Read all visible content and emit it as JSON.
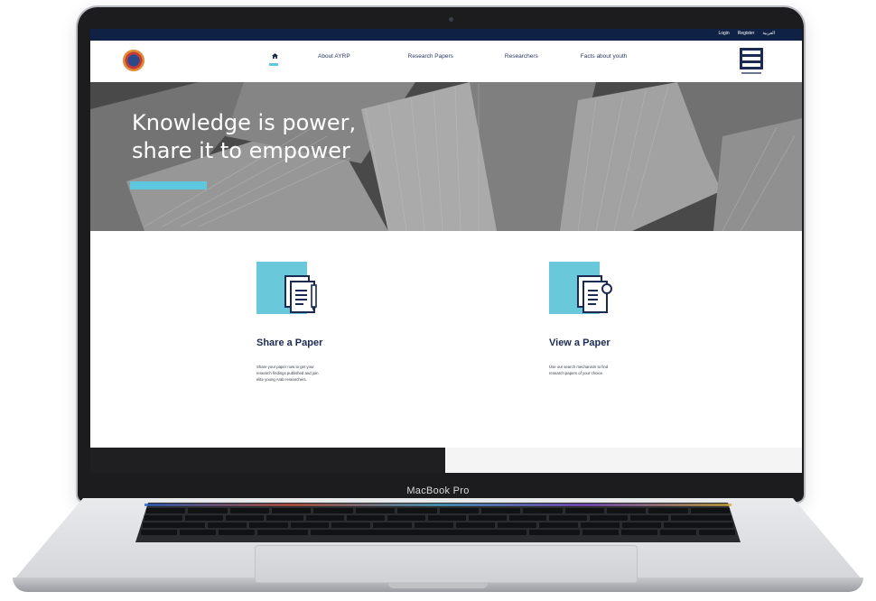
{
  "device": {
    "label": "MacBook Pro"
  },
  "topbar": {
    "links": [
      {
        "label": "Login"
      },
      {
        "label": "Register"
      },
      {
        "label": "العربية"
      }
    ]
  },
  "header": {
    "nav": [
      {
        "label": "",
        "icon": "home-icon"
      },
      {
        "label": "About AYRP"
      },
      {
        "label": "Research Papers"
      },
      {
        "label": "Researchers"
      },
      {
        "label": "Facts about youth"
      }
    ]
  },
  "hero": {
    "line1": "Knowledge is power,",
    "line2": "share it to empower"
  },
  "cards": [
    {
      "title": "Share a Paper",
      "text": "Share your paper now to get your research findings published and join elite young Arab researchers.",
      "icon": "document-pen-icon"
    },
    {
      "title": "View a Paper",
      "text": "Use our search mechanism to find research papers of your choice.",
      "icon": "document-search-icon"
    }
  ],
  "colors": {
    "topbar": "#0f2246",
    "accent": "#5ec8e0",
    "card_square": "#69c8da",
    "text_dark": "#1b2a52"
  }
}
